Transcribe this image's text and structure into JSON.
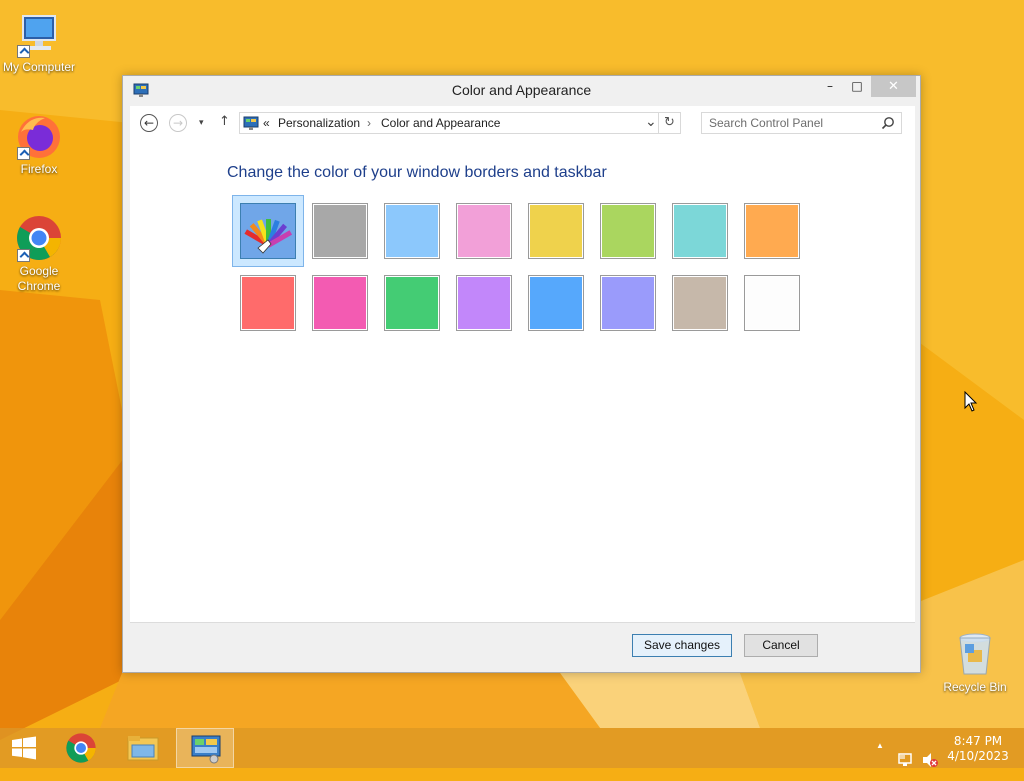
{
  "desktop": {
    "icons": [
      {
        "label": "My Computer",
        "icon": "computer-icon"
      },
      {
        "label": "Firefox",
        "icon": "firefox-icon"
      },
      {
        "label": "Google Chrome",
        "icon": "chrome-icon"
      },
      {
        "label": "Recycle Bin",
        "icon": "recycle-bin-icon"
      }
    ]
  },
  "window": {
    "title": "Color and Appearance",
    "controls": {
      "minimize": "–",
      "maximize": "□",
      "close": "✕"
    },
    "nav": {
      "back": "←",
      "forward": "→",
      "history": "▾",
      "up": "↑",
      "breadcrumb_prefix": "«",
      "breadcrumb": [
        "Personalization",
        "Color and Appearance"
      ],
      "separator": "›",
      "dropdown": "⌄",
      "refresh": "↻",
      "search_placeholder": "Search Control Panel"
    },
    "heading": "Change the color of your window borders and taskbar",
    "swatches": {
      "selected": "Automatic",
      "colors": [
        "#a8a8a8",
        "#8cc8fc",
        "#f2a0d8",
        "#efd24c",
        "#aad65f",
        "#7cd7d8",
        "#ffaa50",
        "#ff6b6b",
        "#f35bb2",
        "#44cc74",
        "#c287fa",
        "#56a8fc",
        "#9a9bfb",
        "#c6b8aa",
        "#fdfdfd"
      ]
    },
    "buttons": {
      "save": "Save changes",
      "cancel": "Cancel"
    }
  },
  "taskbar": {
    "items": [
      "start-icon",
      "chrome-icon",
      "file-explorer-icon",
      "control-panel-icon"
    ],
    "tray": {
      "expand": "▲"
    },
    "time": "8:47 PM",
    "date": "4/10/2023"
  }
}
